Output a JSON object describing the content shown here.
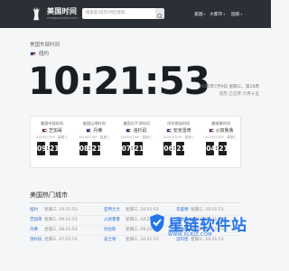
{
  "header": {
    "logo_title": "美国时间",
    "logo_sub": "meiguoshijian.com",
    "search_placeholder": "搜索影/城市/时区搜索...",
    "nav": [
      {
        "label": "美国"
      },
      {
        "label": "大都市"
      },
      {
        "label": "国家"
      }
    ]
  },
  "hero": {
    "heading": "美国东部时间",
    "location": "纽约",
    "time": "10:21:53",
    "date_line": "2025年7月9日 星期三，第28周",
    "lunar_line": "农历 乙巳年 六月十五"
  },
  "cards": [
    {
      "name": "美国中部时间",
      "city": "芝加哥",
      "date": "2025/07/09 · 星期三",
      "hh": "09",
      "mm": "21"
    },
    {
      "name": "美国山地时间",
      "city": "丹佛",
      "date": "2025/07/09 · 星期三",
      "hh": "08",
      "mm": "21"
    },
    {
      "name": "美国太平洋时间",
      "city": "洛杉矶",
      "date": "2025/07/09 · 星期三",
      "hh": "07",
      "mm": "21"
    },
    {
      "name": "阿拉斯加时间",
      "city": "安克雷奇",
      "date": "2025/07/09 · 星期三",
      "hh": "06",
      "mm": "21"
    },
    {
      "name": "夏威夷时间",
      "city": "火奴鲁鲁",
      "date": "2025/07/09 · 星期三",
      "hh": "04",
      "mm": "21"
    }
  ],
  "cities_section": {
    "title": "美国热门城市",
    "rows": [
      [
        {
          "city": "纽约",
          "time": "星期三, 10:21:53"
        },
        {
          "city": "亚特兰大",
          "time": "星期三, 10:21:53"
        },
        {
          "city": "华盛顿",
          "time": "星期三, 10:21:53"
        }
      ],
      [
        {
          "city": "芝加哥",
          "time": "星期三, 09:21:53"
        },
        {
          "city": "火奴鲁鲁",
          "time": "星期三, 04:21:53"
        },
        {
          "city": "圣地亚",
          "time": "星期三, 07:21:53"
        }
      ],
      [
        {
          "city": "丹佛",
          "time": "星期三, 08:21:53"
        },
        {
          "city": "达拉斯",
          "time": "星期三, 09:21:53"
        },
        {
          "city": "西雅图",
          "time": "星期三, 07:21:53"
        }
      ],
      [
        {
          "city": "洛杉矶",
          "time": "星期三, 07:21:53"
        },
        {
          "city": "波士顿",
          "time": "星期三, 10:21:53"
        },
        {
          "city": "迈阿密",
          "time": "星期三, 10:21:53"
        }
      ]
    ]
  },
  "watermark": {
    "text": "星链软件站",
    "url": "WWW.XLRJZ.COM"
  },
  "colors": {
    "topbar": "#2b3036",
    "link": "#2a6fd1",
    "watermark": "#2575e8"
  }
}
